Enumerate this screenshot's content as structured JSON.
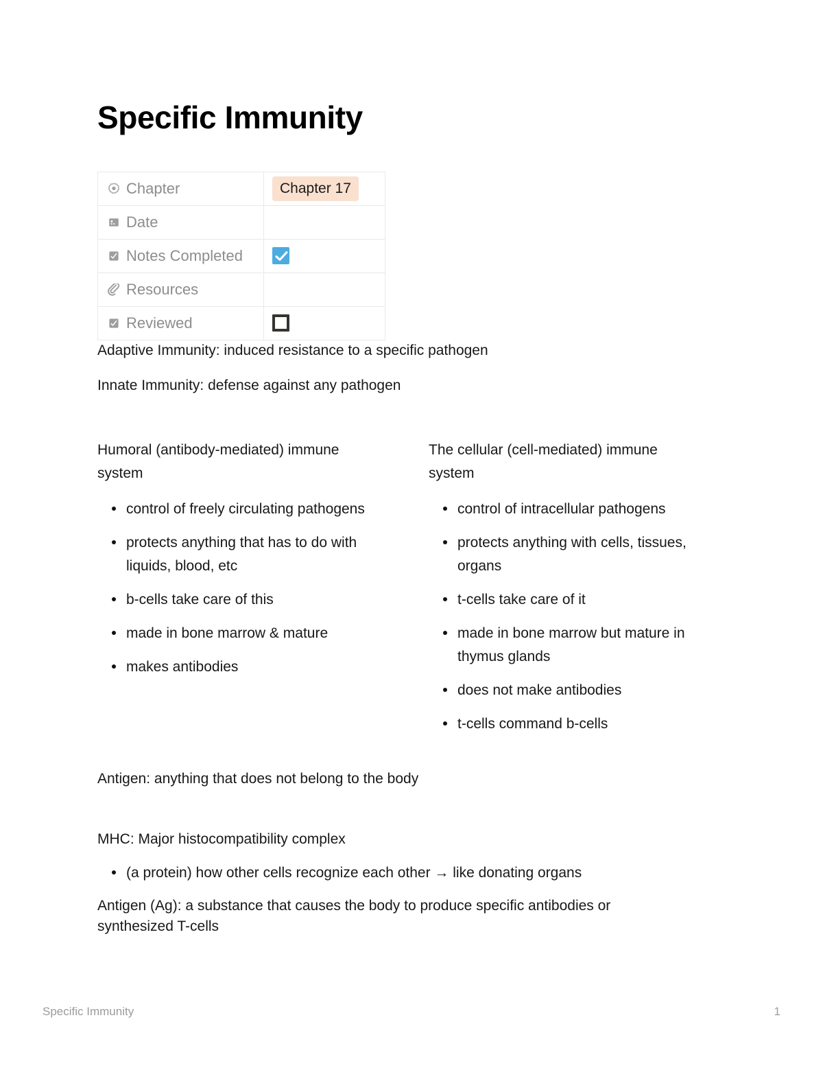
{
  "document": {
    "title": "Specific Immunity"
  },
  "properties": {
    "rows": [
      {
        "icon": "target-badge-icon",
        "label": "Chapter",
        "value_type": "pill",
        "value": "Chapter 17"
      },
      {
        "icon": "calendar-icon",
        "label": "Date",
        "value_type": "empty",
        "value": ""
      },
      {
        "icon": "checkbox-icon",
        "label": "Notes Completed",
        "value_type": "checkbox",
        "value": "checked"
      },
      {
        "icon": "paperclip-icon",
        "label": "Resources",
        "value_type": "empty",
        "value": ""
      },
      {
        "icon": "checkbox-icon",
        "label": "Reviewed",
        "value_type": "checkbox",
        "value": "unchecked"
      }
    ]
  },
  "intro": {
    "line1": "Adaptive Immunity: induced resistance to a specific pathogen",
    "line2": "Innate Immunity: defense against any pathogen"
  },
  "columns": {
    "left": {
      "heading": "Humoral (antibody-mediated) immune system",
      "bullets": [
        "control of freely circulating pathogens",
        "protects anything that has to do with liquids, blood, etc",
        "b-cells take care of this",
        "made in bone marrow & mature",
        "makes antibodies"
      ]
    },
    "right": {
      "heading": "The cellular (cell-mediated) immune system",
      "bullets": [
        "control of intracellular pathogens",
        "protects anything with cells, tissues, organs",
        "t-cells take care of it",
        "made in bone marrow but mature in thymus glands",
        "does not make antibodies",
        "t-cells command b-cells"
      ]
    }
  },
  "lower": {
    "antigen_line": "Antigen: anything that does not belong to the body",
    "mhc_line": "MHC: Major histocompatibility complex",
    "mhc_bullet": "(a protein) how other cells recognize each other → like donating organs",
    "antigen_ag_line": "Antigen (Ag): a substance that causes the body to produce specific antibodies or synthesized T-cells"
  },
  "footer": {
    "left": "Specific Immunity",
    "page_number": "1"
  },
  "colors": {
    "pill_background": "#fae0cf",
    "checkbox_checked": "#4dabe0",
    "checkbox_unchecked_border": "#363430",
    "table_border": "#e9e9e9",
    "property_label": "#8d8d8d",
    "footer_text": "#9b9b9b"
  }
}
